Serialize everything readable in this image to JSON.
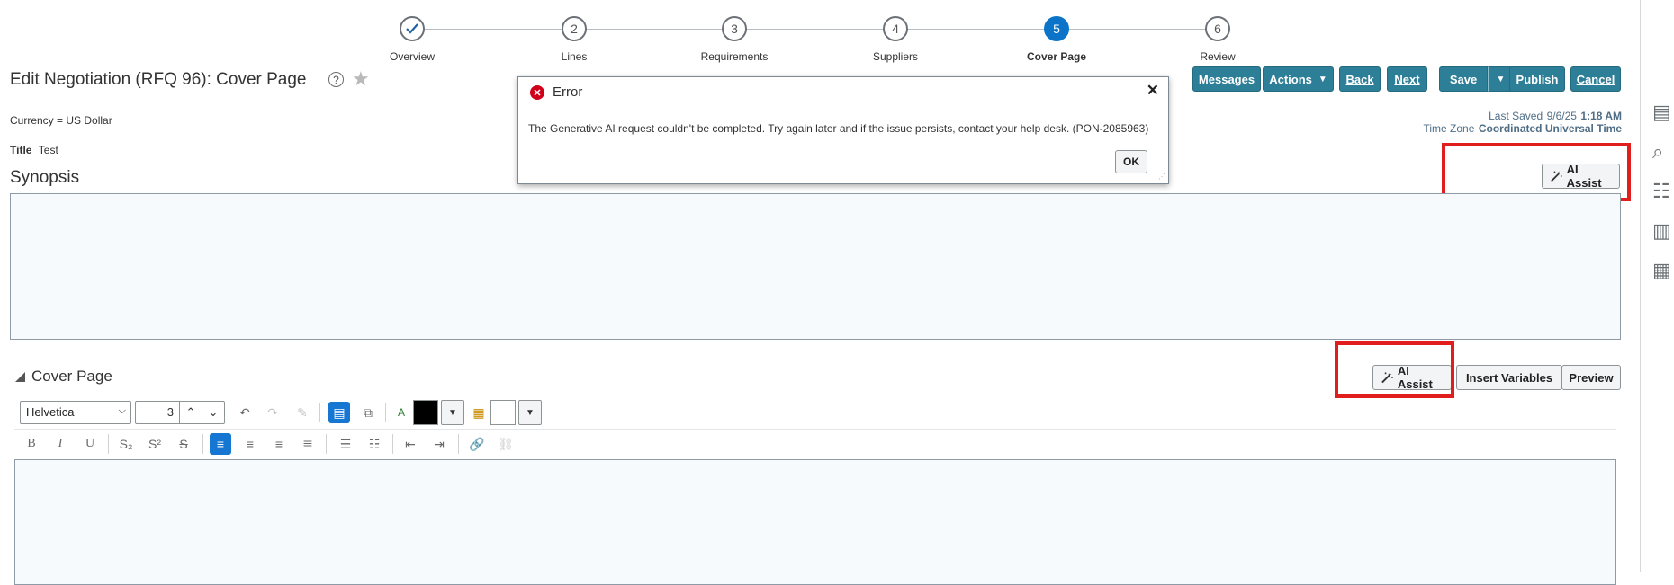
{
  "train": {
    "steps": [
      {
        "number": "",
        "label": "Overview",
        "state": "done"
      },
      {
        "number": "2",
        "label": "Lines",
        "state": "todo"
      },
      {
        "number": "3",
        "label": "Requirements",
        "state": "todo"
      },
      {
        "number": "4",
        "label": "Suppliers",
        "state": "todo"
      },
      {
        "number": "5",
        "label": "Cover Page",
        "state": "current"
      },
      {
        "number": "6",
        "label": "Review",
        "state": "todo"
      }
    ]
  },
  "header": {
    "title": "Edit Negotiation (RFQ 96): Cover Page",
    "help_symbol": "?",
    "favorite_symbol": "★"
  },
  "toolbar": {
    "messages": "Messages",
    "actions": "Actions",
    "back": "Back",
    "next": "Next",
    "save": "Save",
    "publish": "Publish",
    "cancel": "Cancel"
  },
  "meta": {
    "last_saved_label": "Last Saved",
    "last_saved_date": "9/6/25",
    "last_saved_time": "1:18 AM",
    "time_zone_label": "Time Zone",
    "time_zone_value": "Coordinated Universal Time"
  },
  "details": {
    "currency": "Currency = US Dollar",
    "title_label": "Title",
    "title_value": "Test"
  },
  "synopsis": {
    "heading": "Synopsis",
    "ai_assist": "AI Assist",
    "text": ""
  },
  "cover_page": {
    "heading": "Cover Page",
    "ai_assist": "AI Assist",
    "insert_variables": "Insert Variables",
    "preview": "Preview",
    "font_family": "Helvetica",
    "font_size": "3",
    "text": ""
  },
  "error_dialog": {
    "title": "Error",
    "message": "The Generative AI request couldn't be completed. Try again later and if the issue persists, contact your help desk. (PON-2085963)",
    "ok": "OK",
    "close_symbol": "✕"
  },
  "colors": {
    "accent_teal": "#2d7e97",
    "current_step": "#0b74c9",
    "annotation_red": "#e01e1e",
    "error_red": "#d0021b"
  }
}
